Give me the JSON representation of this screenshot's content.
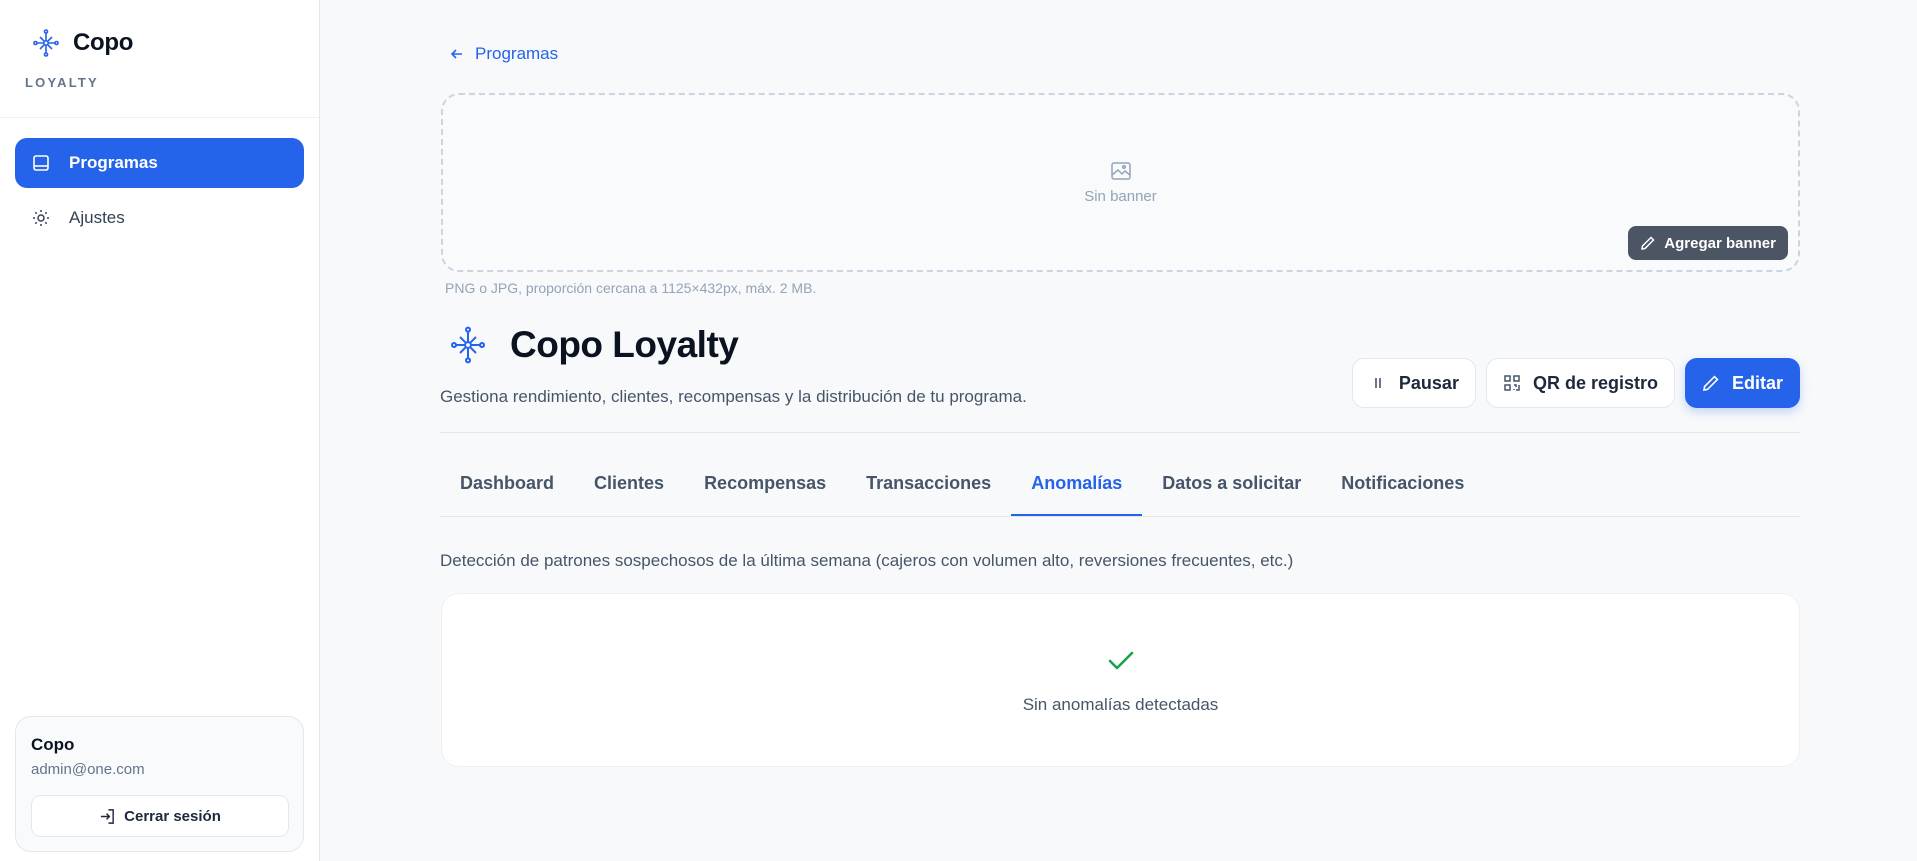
{
  "brand": {
    "name": "Copo",
    "subtitle": "LOYALTY",
    "accent": "#2563eb"
  },
  "sidebar": {
    "items": [
      {
        "label": "Programas",
        "icon": "book-icon",
        "active": true
      },
      {
        "label": "Ajustes",
        "icon": "sun-icon",
        "active": false
      }
    ],
    "user": {
      "name": "Copo",
      "email": "admin@one.com",
      "logout_label": "Cerrar sesión"
    }
  },
  "main": {
    "back_label": "Programas",
    "banner": {
      "empty_label": "Sin banner",
      "add_label": "Agregar banner",
      "hint": "PNG o JPG, proporción cercana a 1125×432px, máx. 2 MB."
    },
    "program": {
      "title": "Copo Loyalty",
      "description": "Gestiona rendimiento, clientes, recompensas y la distribución de tu programa."
    },
    "actions": {
      "pause_label": "Pausar",
      "qr_label": "QR de registro",
      "edit_label": "Editar"
    },
    "tabs": [
      {
        "label": "Dashboard"
      },
      {
        "label": "Clientes"
      },
      {
        "label": "Recompensas"
      },
      {
        "label": "Transacciones"
      },
      {
        "label": "Anomalías",
        "active": true
      },
      {
        "label": "Datos a solicitar"
      },
      {
        "label": "Notificaciones"
      }
    ],
    "section_description": "Detección de patrones sospechosos de la última semana (cajeros con volumen alto, reversiones frecuentes, etc.)",
    "empty_state": "Sin anomalías detectadas",
    "success_color": "#16a34a"
  }
}
